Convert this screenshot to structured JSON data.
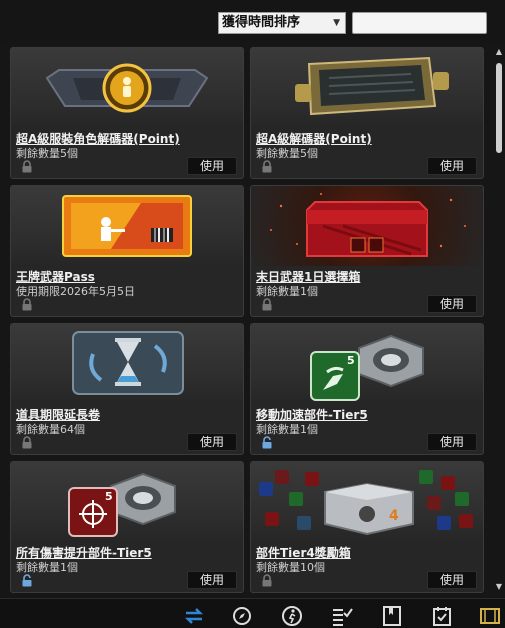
{
  "toolbar": {
    "sort_label": "獲得時間排序",
    "search_value": "",
    "search_placeholder": ""
  },
  "items": [
    {
      "name": "超A級服裝角色解碼器(Point)",
      "sub": "剩餘數量5個",
      "button": "使用",
      "icon": "gold-badge-decoder-icon",
      "lock": "locked"
    },
    {
      "name": "超A級解碼器(Point)",
      "sub": "剩餘數量5個",
      "button": "使用",
      "icon": "decoder-device-icon",
      "lock": "locked"
    },
    {
      "name": "王牌武器Pass",
      "sub": "使用期限2026年5月5日",
      "button": "",
      "icon": "weapon-pass-ticket-icon",
      "lock": "locked"
    },
    {
      "name": "末日武器1日選擇箱",
      "sub": "剩餘數量1個",
      "button": "使用",
      "icon": "red-weapon-box-icon",
      "lock": "locked"
    },
    {
      "name": "道具期限延長卷",
      "sub": "剩餘數量64個",
      "button": "使用",
      "icon": "hourglass-extension-icon",
      "lock": "locked"
    },
    {
      "name": "移動加速部件-Tier5",
      "sub": "剩餘數量1個",
      "button": "使用",
      "icon": "speed-part-icon",
      "badge": "5",
      "lock": "unlocked"
    },
    {
      "name": "所有傷害提升部件-Tier5",
      "sub": "剩餘數量1個",
      "button": "使用",
      "icon": "damage-part-icon",
      "badge": "5",
      "lock": "unlocked"
    },
    {
      "name": "部件Tier4獎勵箱",
      "sub": "剩餘數量10個",
      "button": "使用",
      "icon": "tier4-reward-box-icon",
      "lock": "locked"
    }
  ],
  "colors": {
    "background": "#161616",
    "card": "#262626",
    "gold": "#e3a51c",
    "red_box": "#b11818",
    "part_green": "#1f6a2b",
    "part_red": "#7a1414",
    "lock_blue": "#6fa8e0"
  },
  "bottom_icons": [
    "swap-arrows-icon",
    "compass-icon",
    "running-man-icon",
    "checklist-icon",
    "bookmark-card-icon",
    "calendar-check-icon",
    "film-icon"
  ]
}
